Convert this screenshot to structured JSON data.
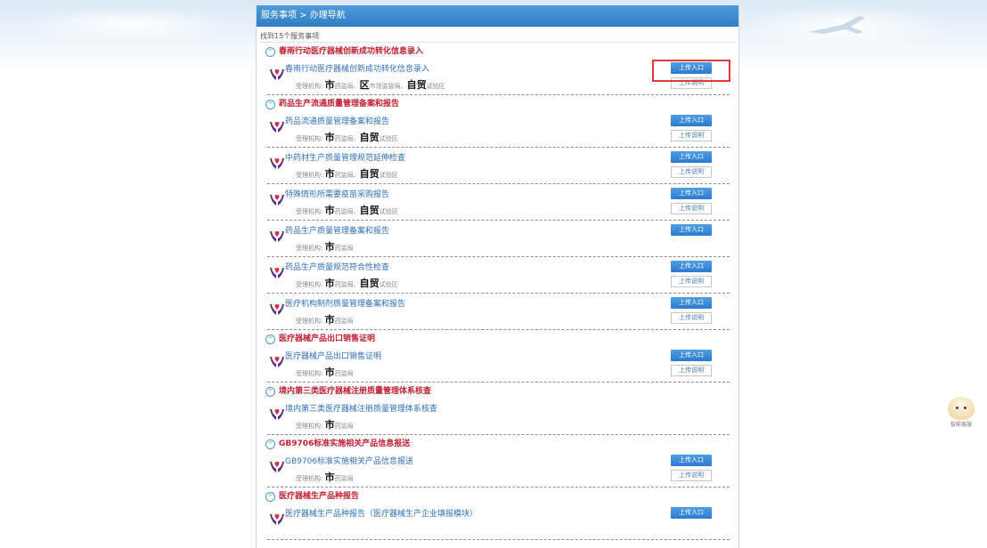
{
  "header": {
    "breadcrumb": "服务事项 > 办理导航"
  },
  "found_text": "找到15个服务事项",
  "colors": {
    "header_blue": "#2f7fc6",
    "group_red": "#c21f31",
    "link_blue": "#2f6fbf",
    "highlight_red": "#e23a3a"
  },
  "icons": {
    "logo": "hands-heart-icon",
    "collapse": "collapse-circle-icon",
    "assistant": "assistant-avatar-icon"
  },
  "groups": [
    {
      "title": "春雨行动医疗器械创新成功转化信息录入",
      "items": [
        {
          "title": "春雨行动医疗器械创新成功转化信息录入",
          "org_label": "受理机构:",
          "org_parts": [
            [
              "市",
              "药监局、"
            ],
            [
              "区",
              "市场监管局、"
            ],
            [
              "自贸",
              "试验区"
            ]
          ],
          "upload": "上传入口",
          "desc": "上传说明"
        }
      ]
    },
    {
      "title": "药品生产流通质量管理备案和报告",
      "items": [
        {
          "title": "药品流通质量管理备案和报告",
          "org_label": "受理机构:",
          "org_parts": [
            [
              "市",
              "药监局、"
            ],
            [
              "自贸",
              "试验区"
            ]
          ],
          "upload": "上传入口",
          "desc": "上传说明"
        },
        {
          "title": "中药材生产质量管理规范延伸检查",
          "org_label": "受理机构:",
          "org_parts": [
            [
              "市",
              "药监局、"
            ],
            [
              "自贸",
              "试验区"
            ]
          ],
          "upload": "上传入口",
          "desc": "上传说明"
        },
        {
          "title": "特殊情形所需要疫苗采购报告",
          "org_label": "受理机构:",
          "org_parts": [
            [
              "市",
              "药监局、"
            ],
            [
              "自贸",
              "试验区"
            ]
          ],
          "upload": "上传入口",
          "desc": "上传说明"
        },
        {
          "title": "药品生产质量管理备案和报告",
          "org_label": "受理机构:",
          "org_parts": [
            [
              "市",
              "药监局"
            ]
          ],
          "upload": "上传入口",
          "desc": ""
        },
        {
          "title": "药品生产质量规范符合性检查",
          "org_label": "受理机构:",
          "org_parts": [
            [
              "市",
              "药监局、"
            ],
            [
              "自贸",
              "试验区"
            ]
          ],
          "upload": "上传入口",
          "desc": "上传说明"
        },
        {
          "title": "医疗机构制剂质量管理备案和报告",
          "org_label": "受理机构:",
          "org_parts": [
            [
              "市",
              "药监局"
            ]
          ],
          "upload": "上传入口",
          "desc": "上传说明"
        }
      ]
    },
    {
      "title": "医疗器械产品出口销售证明",
      "items": [
        {
          "title": "医疗器械产品出口销售证明",
          "org_label": "受理机构:",
          "org_parts": [
            [
              "市",
              "药监局"
            ]
          ],
          "upload": "上传入口",
          "desc": "上传说明"
        }
      ]
    },
    {
      "title": "境内第三类医疗器械注册质量管理体系核查",
      "items": [
        {
          "title": "境内第三类医疗器械注册质量管理体系核查",
          "org_label": "受理机构:",
          "org_parts": [
            [
              "市",
              "药监局"
            ]
          ],
          "upload": "",
          "desc": ""
        }
      ]
    },
    {
      "title": "GB9706标准实施相关产品信息报送",
      "items": [
        {
          "title": "GB9706标准实施相关产品信息报送",
          "org_label": "受理机构:",
          "org_parts": [
            [
              "市",
              "药监局"
            ]
          ],
          "upload": "上传入口",
          "desc": "上传说明"
        }
      ]
    },
    {
      "title": "医疗器械生产品种报告",
      "items": [
        {
          "title": "医疗器械生产品种报告（医疗器械生产企业填报模块）",
          "org_label": "",
          "org_parts": [],
          "upload": "上传入口",
          "desc": ""
        }
      ]
    }
  ],
  "assistant": {
    "label": "智能客服"
  }
}
